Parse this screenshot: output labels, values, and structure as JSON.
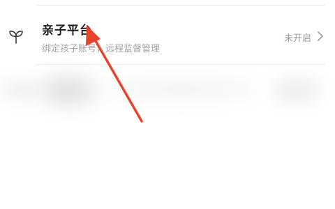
{
  "settings_row": {
    "title": "亲子平台",
    "subtitle": "绑定孩子账号，远程监督管理",
    "status": "未开启",
    "icon": "sprout-icon"
  },
  "colors": {
    "title": "#1f1f1f",
    "subtitle": "#a3a3a3",
    "status": "#9a9a9a",
    "annotation": "#e8432d"
  }
}
